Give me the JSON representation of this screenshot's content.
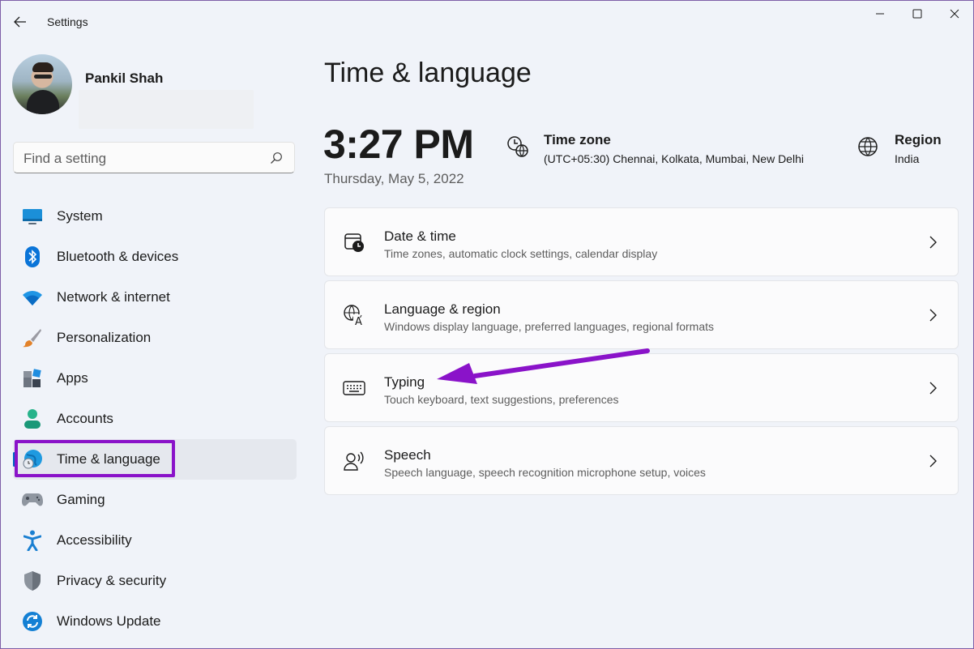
{
  "app": {
    "title": "Settings",
    "window_controls": [
      "minimize",
      "maximize",
      "close"
    ]
  },
  "profile": {
    "name": "Pankil Shah"
  },
  "search": {
    "placeholder": "Find a setting"
  },
  "sidebar": {
    "items": [
      {
        "label": "System",
        "icon": "monitor-icon"
      },
      {
        "label": "Bluetooth & devices",
        "icon": "bluetooth-icon"
      },
      {
        "label": "Network & internet",
        "icon": "wifi-icon"
      },
      {
        "label": "Personalization",
        "icon": "brush-icon"
      },
      {
        "label": "Apps",
        "icon": "apps-icon"
      },
      {
        "label": "Accounts",
        "icon": "person-icon"
      },
      {
        "label": "Time & language",
        "icon": "globe-clock-icon",
        "active": true
      },
      {
        "label": "Gaming",
        "icon": "gamepad-icon"
      },
      {
        "label": "Accessibility",
        "icon": "accessibility-icon"
      },
      {
        "label": "Privacy & security",
        "icon": "shield-icon"
      },
      {
        "label": "Windows Update",
        "icon": "update-icon"
      }
    ]
  },
  "main": {
    "title": "Time & language",
    "time": "3:27 PM",
    "date": "Thursday, May 5, 2022",
    "time_zone": {
      "title": "Time zone",
      "value": "(UTC+05:30) Chennai, Kolkata, Mumbai, New Delhi"
    },
    "region": {
      "title": "Region",
      "value": "India"
    },
    "cards": [
      {
        "title": "Date & time",
        "subtitle": "Time zones, automatic clock settings, calendar display",
        "icon": "calendar-clock-icon"
      },
      {
        "title": "Language & region",
        "subtitle": "Windows display language, preferred languages, regional formats",
        "icon": "language-icon"
      },
      {
        "title": "Typing",
        "subtitle": "Touch keyboard, text suggestions, preferences",
        "icon": "keyboard-icon"
      },
      {
        "title": "Speech",
        "subtitle": "Speech language, speech recognition microphone setup, voices",
        "icon": "speech-icon"
      }
    ]
  },
  "colors": {
    "accent": "#0067c0",
    "annotation": "#8a13c9",
    "background": "#f0f3f9"
  }
}
